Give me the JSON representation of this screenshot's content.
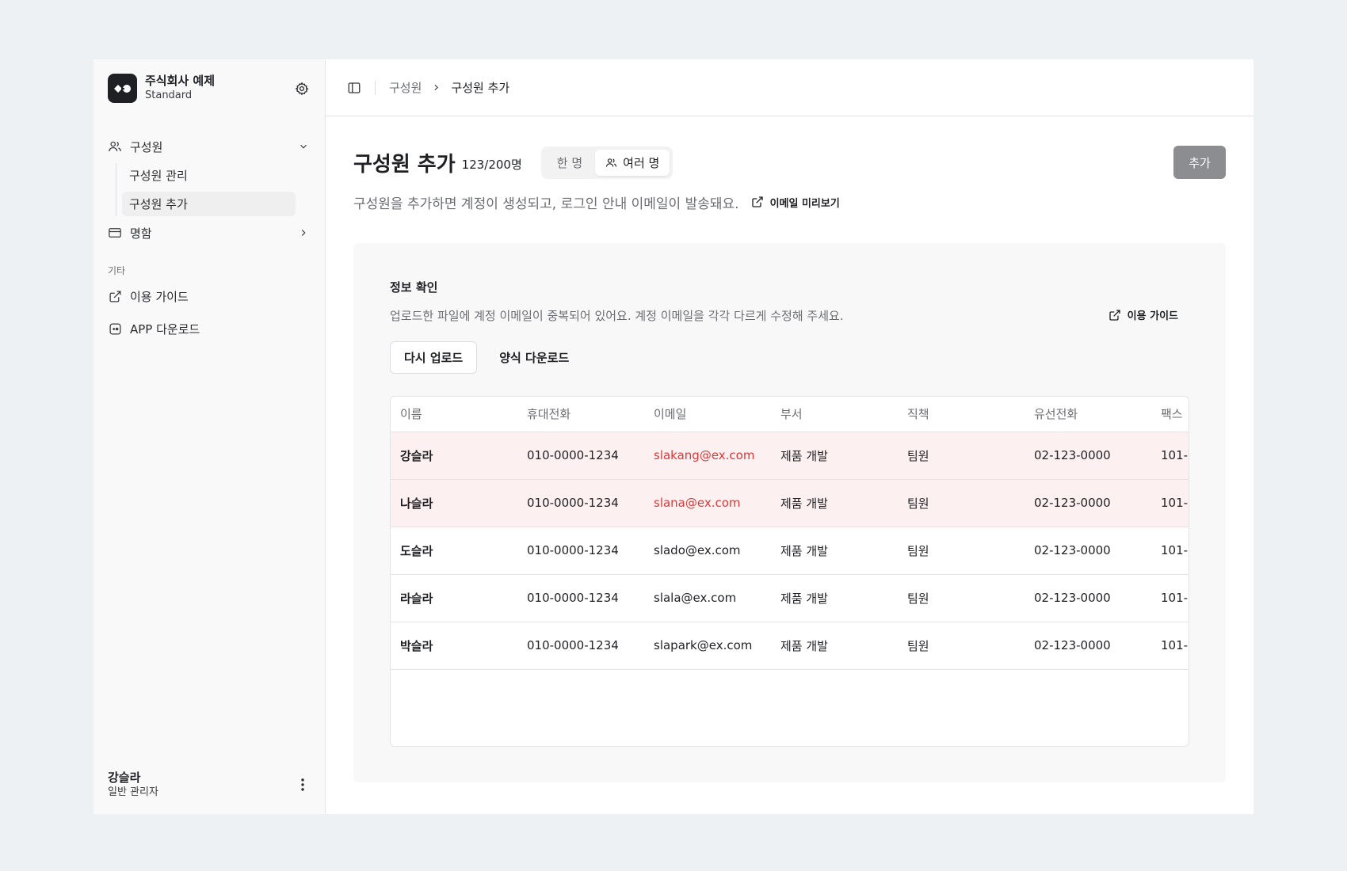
{
  "sidebar": {
    "org_name": "주식회사 예제",
    "org_plan": "Standard",
    "nav": {
      "members": "구성원",
      "members_manage": "구성원 관리",
      "members_add": "구성원 추가",
      "cards": "명함"
    },
    "etc_label": "기타",
    "guide": "이용 가이드",
    "app_download": "APP 다운로드",
    "user_name": "강슬라",
    "user_role": "일반 관리자"
  },
  "breadcrumb": {
    "parent": "구성원",
    "current": "구성원 추가"
  },
  "header": {
    "title": "구성원 추가",
    "count": "123/200명",
    "segment_single": "한 명",
    "segment_multi": "여러 명",
    "add_button": "추가",
    "description": "구성원을 추가하면 계정이 생성되고, 로그인 안내 이메일이 발송돼요.",
    "email_preview": "이메일 미리보기"
  },
  "panel": {
    "title": "정보 확인",
    "description": "업로드한 파일에 계정 이메일이 중복되어 있어요. 계정 이메일을 각각 다르게 수정해 주세요.",
    "guide_link": "이용 가이드",
    "reupload": "다시 업로드",
    "template_download": "양식 다운로드"
  },
  "table": {
    "headers": [
      "이름",
      "휴대전화",
      "이메일",
      "부서",
      "직책",
      "유선전화",
      "팩스"
    ],
    "rows": [
      {
        "name": "강슬라",
        "mobile": "010-0000-1234",
        "email": "slakang@ex.com",
        "dept": "제품 개발",
        "position": "팀원",
        "phone": "02-123-0000",
        "fax": "101-"
      },
      {
        "name": "나슬라",
        "mobile": "010-0000-1234",
        "email": "slana@ex.com",
        "dept": "제품 개발",
        "position": "팀원",
        "phone": "02-123-0000",
        "fax": "101-"
      },
      {
        "name": "도슬라",
        "mobile": "010-0000-1234",
        "email": "slado@ex.com",
        "dept": "제품 개발",
        "position": "팀원",
        "phone": "02-123-0000",
        "fax": "101-"
      },
      {
        "name": "라슬라",
        "mobile": "010-0000-1234",
        "email": "slala@ex.com",
        "dept": "제품 개발",
        "position": "팀원",
        "phone": "02-123-0000",
        "fax": "101-"
      },
      {
        "name": "박슬라",
        "mobile": "010-0000-1234",
        "email": "slapark@ex.com",
        "dept": "제품 개발",
        "position": "팀원",
        "phone": "02-123-0000",
        "fax": "101-"
      }
    ]
  },
  "colors": {
    "background": "#eef1f4",
    "duplicate_row": "#fdf0f0",
    "duplicate_email": "#d93a3a",
    "add_button": "#8c8d91"
  },
  "icons": {
    "org_logo": "logo-icon",
    "settings": "gear-icon",
    "members": "users-icon",
    "cards": "card-icon",
    "guide": "external-link-icon",
    "app": "app-icon",
    "more": "kebab-icon",
    "sidebar_toggle": "sidebar-panel-icon"
  }
}
